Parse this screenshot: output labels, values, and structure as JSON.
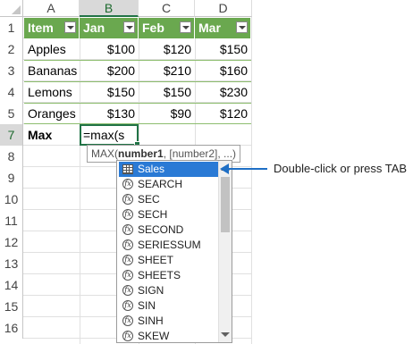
{
  "columns": [
    "A",
    "B",
    "C",
    "D"
  ],
  "active_column": "B",
  "rows": [
    "1",
    "2",
    "3",
    "4",
    "5",
    "6",
    "7",
    "8",
    "9",
    "10",
    "11",
    "12",
    "13",
    "14",
    "15",
    "16"
  ],
  "table": {
    "headers": [
      "Item",
      "Jan",
      "Feb",
      "Mar"
    ],
    "data": [
      [
        "Apples",
        "$100",
        "$120",
        "$150"
      ],
      [
        "Bananas",
        "$200",
        "$210",
        "$160"
      ],
      [
        "Lemons",
        "$150",
        "$150",
        "$230"
      ],
      [
        "Oranges",
        "$130",
        "$90",
        "$120"
      ]
    ]
  },
  "row7": {
    "label": "Max",
    "formula": "=max(s"
  },
  "tooltip": {
    "fn": "MAX(",
    "arg1": "number1",
    "rest": ", [number2], ...)"
  },
  "autocomplete": {
    "selected": "Sales",
    "items": [
      "Sales",
      "SEARCH",
      "SEC",
      "SECH",
      "SECOND",
      "SERIESSUM",
      "SHEET",
      "SHEETS",
      "SIGN",
      "SIN",
      "SINH",
      "SKEW"
    ]
  },
  "callout": "Double-click or press TAB",
  "colors": {
    "header_green": "#6aa84f",
    "selection_blue": "#2a7ad5",
    "callout_blue": "#1f6fc5"
  }
}
